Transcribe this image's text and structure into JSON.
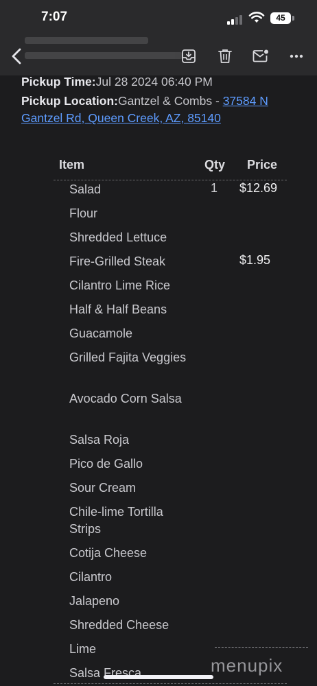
{
  "status_bar": {
    "time": "7:07",
    "battery": "45"
  },
  "toolbar": {
    "icons": [
      "back-chevron-icon",
      "archive-icon",
      "trash-icon",
      "mark-unread-icon",
      "more-icon"
    ]
  },
  "order": {
    "pickup_time_label": "Pickup Time:",
    "pickup_time_value": "Jul 28 2024 06:40 PM",
    "pickup_location_label": "Pickup Location:",
    "pickup_location_value": "Gantzel & Combs - ",
    "address_line1": "37584 N",
    "address_line2": "Gantzel Rd, Queen Creek, AZ, 85140"
  },
  "table": {
    "headers": {
      "item": "Item",
      "qty": "Qty",
      "price": "Price"
    },
    "rows": [
      {
        "item": "Salad",
        "qty": "1",
        "price": "$12.69"
      },
      {
        "item": "Flour",
        "qty": "",
        "price": ""
      },
      {
        "item": "Shredded Lettuce",
        "qty": "",
        "price": ""
      },
      {
        "item": "Fire-Grilled Steak",
        "qty": "",
        "price": "$1.95"
      },
      {
        "item": "Cilantro Lime Rice",
        "qty": "",
        "price": ""
      },
      {
        "item": "Half & Half Beans",
        "qty": "",
        "price": ""
      },
      {
        "item": "Guacamole",
        "qty": "",
        "price": ""
      },
      {
        "item": "Grilled Fajita Veggies",
        "qty": "",
        "price": ""
      },
      {
        "item": "Avocado Corn Salsa",
        "qty": "",
        "price": ""
      },
      {
        "item": "Salsa Roja",
        "qty": "",
        "price": ""
      },
      {
        "item": "Pico de Gallo",
        "qty": "",
        "price": ""
      },
      {
        "item": "Sour Cream",
        "qty": "",
        "price": ""
      },
      {
        "item": "Chile-lime Tortilla Strips",
        "qty": "",
        "price": ""
      },
      {
        "item": "Cotija Cheese",
        "qty": "",
        "price": ""
      },
      {
        "item": "Cilantro",
        "qty": "",
        "price": ""
      },
      {
        "item": "Jalapeno",
        "qty": "",
        "price": ""
      },
      {
        "item": "Shredded Cheese",
        "qty": "",
        "price": ""
      },
      {
        "item": "Lime",
        "qty": "",
        "price": ""
      },
      {
        "item": "Salsa Fresca",
        "qty": "",
        "price": ""
      }
    ]
  },
  "watermark": "menupix"
}
